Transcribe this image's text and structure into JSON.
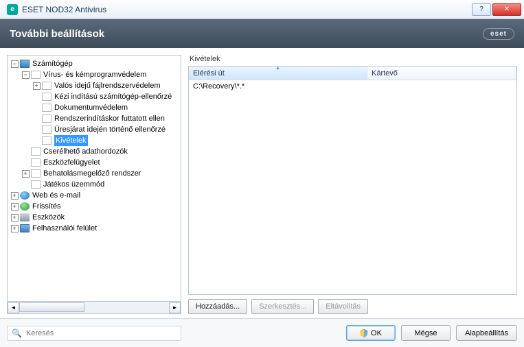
{
  "window": {
    "title": "ESET NOD32 Antivirus"
  },
  "header": {
    "title": "További beállítások",
    "logo": "eset"
  },
  "tree": {
    "root": "Számítógép",
    "n_virus": "Vírus- és kémprogramvédelem",
    "n_realtime": "Valós idejű fájlrendszervédelem",
    "n_manual": "Kézi indítású számítógép-ellenőrzé",
    "n_docprot": "Dokumentumvédelem",
    "n_startup": "Rendszerindításkor futtatott ellen",
    "n_idle": "Üresjárat idején történő ellenőrzé",
    "n_exceptions": "Kivételek",
    "n_removable": "Cserélhető adathordozók",
    "n_device": "Eszközfelügyelet",
    "n_hips": "Behatolásmegelőző rendszer",
    "n_gamer": "Játékos üzemmód",
    "n_web": "Web és e-mail",
    "n_update": "Frissítés",
    "n_tools": "Eszközök",
    "n_ui": "Felhasználói felület"
  },
  "panel": {
    "group_label": "Kivételek",
    "columns": {
      "path": "Elérési út",
      "threat": "Kártevő"
    },
    "rows": [
      {
        "path": "C:\\Recovery\\*.*",
        "threat": ""
      }
    ],
    "buttons": {
      "add": "Hozzáadás...",
      "edit": "Szerkesztés...",
      "remove": "Eltávolítás"
    }
  },
  "search": {
    "placeholder": "Keresés"
  },
  "footer": {
    "ok": "OK",
    "cancel": "Mégse",
    "default": "Alapbeállítás"
  }
}
